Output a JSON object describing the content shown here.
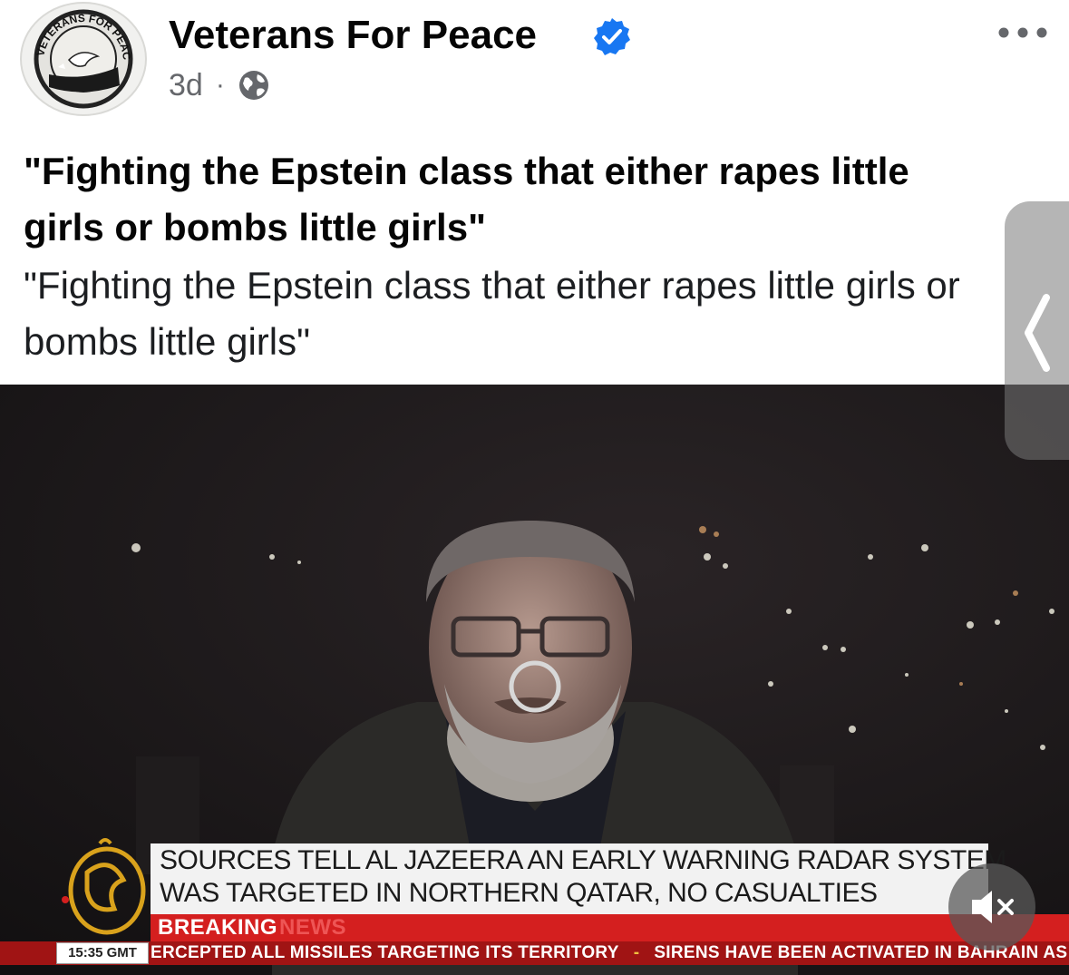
{
  "post": {
    "page_name": "Veterans For Peace",
    "timestamp": "3d",
    "separator": "·",
    "audience_icon": "globe-icon",
    "verified_icon": "verified-badge-icon",
    "more_icon": "more-options-icon",
    "avatar_text": "VETERANS FOR PEACE",
    "headline": "\"Fighting the Epstein class that either rapes little girls or bombs little girls\"",
    "description": "\"Fighting the Epstein class that either rapes little girls or bombs little girls\""
  },
  "video": {
    "ticker": {
      "line1": "SOURCES TELL AL JAZEERA AN EARLY WARNING RADAR SYSTEM",
      "line2": "WAS TARGETED IN NORTHERN QATAR, NO CASUALTIES"
    },
    "breaking_label": "BREAKING",
    "breaking_suffix": "NEWS",
    "clock": "15:35 GMT",
    "crawl_left": "ERCEPTED ALL MISSILES TARGETING ITS TERRITORY",
    "crawl_right": "SIRENS HAVE BEEN ACTIVATED IN BAHRAIN AS IN",
    "crawl_separator": "-",
    "mute_icon": "speaker-muted-icon",
    "loading_icon": "loading-spinner-icon",
    "logo_icon": "al-jazeera-logo-icon"
  },
  "overlay": {
    "side_handle_icon": "chevron-left-icon"
  },
  "colors": {
    "verified_blue": "#1877f2",
    "breaking_red": "#d41f1f",
    "crawl_red": "#a01414",
    "aj_gold": "#d9a21c"
  }
}
